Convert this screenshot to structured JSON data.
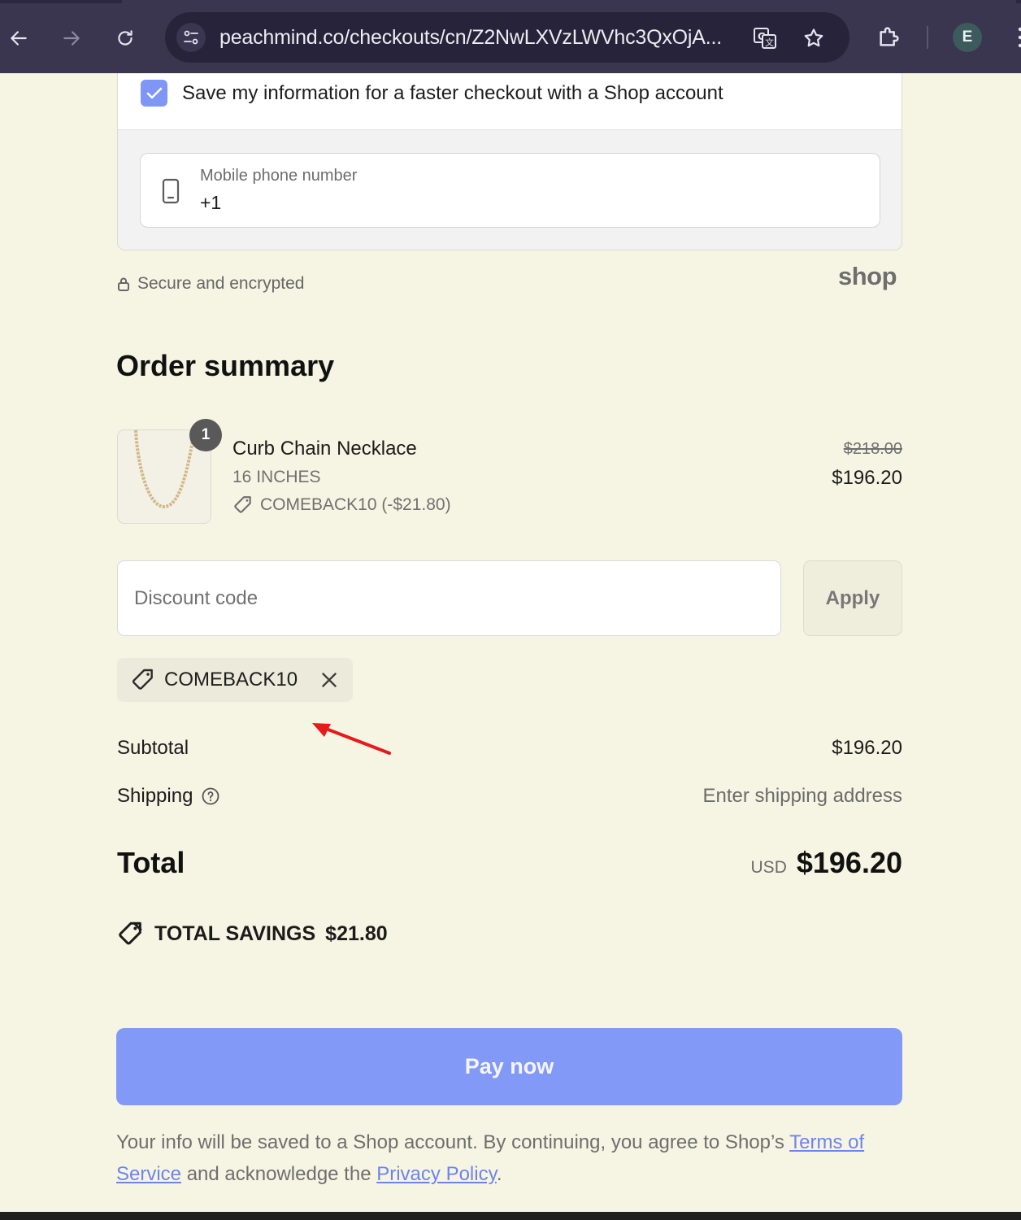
{
  "browser": {
    "url": "peachmind.co/checkouts/cn/Z2NwLXVzLWVhc3QxOjA...",
    "profile_initial": "E"
  },
  "shop_save": {
    "checkbox_label": "Save my information for a faster checkout with a Shop account",
    "checkbox_checked": true,
    "phone_label": "Mobile phone number",
    "phone_value": "+1"
  },
  "secure_text": "Secure and encrypted",
  "shop_logo": "shop",
  "order_summary": {
    "title": "Order summary",
    "item": {
      "quantity": "1",
      "name": "Curb Chain Necklace",
      "variant": "16 INCHES",
      "discount": "COMEBACK10 (-$21.80)",
      "original_price": "$218.00",
      "price": "$196.20"
    },
    "discount_placeholder": "Discount code",
    "apply_label": "Apply",
    "applied_code": "COMEBACK10",
    "subtotal_label": "Subtotal",
    "subtotal_value": "$196.20",
    "shipping_label": "Shipping",
    "shipping_value": "Enter shipping address",
    "total_label": "Total",
    "total_currency": "USD",
    "total_value": "$196.20",
    "savings_label": "TOTAL SAVINGS",
    "savings_value": "$21.80"
  },
  "pay_button": "Pay now",
  "legal": {
    "text_before": "Your info will be saved to a Shop account. By continuing, you agree to Shop’s ",
    "terms_link": "Terms of Service",
    "text_middle": " and acknowledge the ",
    "privacy_link": "Privacy Policy",
    "text_after": "."
  },
  "colors": {
    "page_bg": "#f6f5e3",
    "accent": "#8399f7",
    "browser_bar": "#3b3650",
    "annotation_arrow": "#e41b1b"
  }
}
